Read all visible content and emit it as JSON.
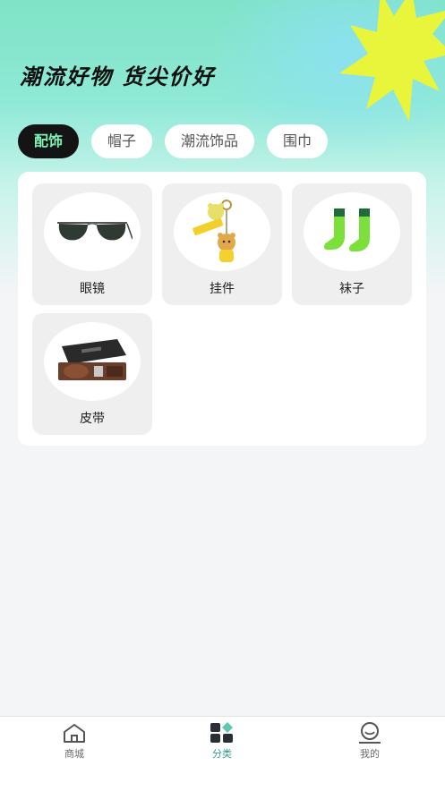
{
  "header": {
    "slogan": "潮流好物  货尖价好",
    "accent_color": "#e9f53a"
  },
  "tabs": [
    {
      "label": "配饰",
      "active": true
    },
    {
      "label": "帽子",
      "active": false
    },
    {
      "label": "潮流饰品",
      "active": false
    },
    {
      "label": "围巾",
      "active": false
    }
  ],
  "products": [
    {
      "label": "眼镜",
      "icon": "sunglasses-icon"
    },
    {
      "label": "挂件",
      "icon": "bear-keychain-icon"
    },
    {
      "label": "袜子",
      "icon": "socks-icon"
    },
    {
      "label": "皮带",
      "icon": "belt-gift-box-icon"
    }
  ],
  "tabbar": [
    {
      "label": "商城",
      "icon": "home-icon",
      "active": false
    },
    {
      "label": "分类",
      "icon": "category-icon",
      "active": true
    },
    {
      "label": "我的",
      "icon": "profile-icon",
      "active": false
    }
  ]
}
